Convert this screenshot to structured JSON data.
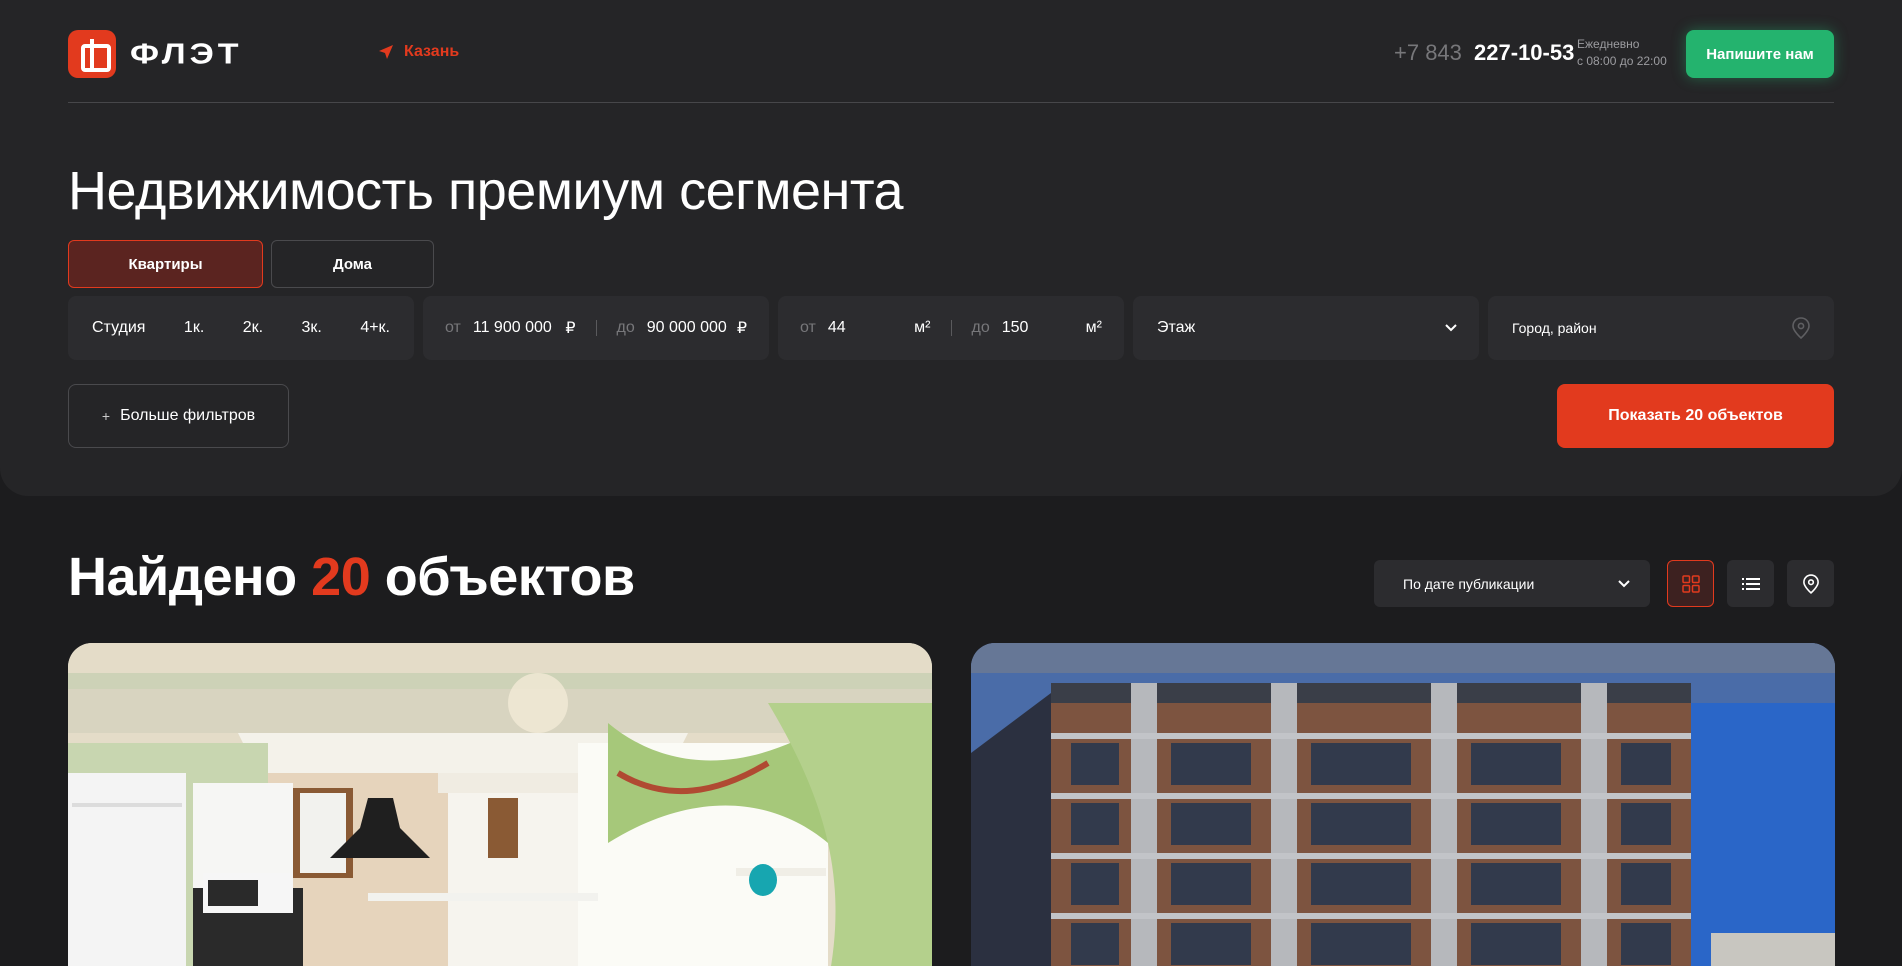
{
  "header": {
    "logo_text": "ФЛЭТ",
    "city": "Казань",
    "phone_prefix": "+7 843",
    "phone_number": "227-10-53",
    "hours_line1": "Ежедневно",
    "hours_line2": "с 08:00 до 22:00",
    "write_button": "Напишите нам"
  },
  "hero": {
    "title": "Недвижимость премиум сегмента",
    "segments": [
      "Квартиры",
      "Дома"
    ],
    "rooms": [
      "Студия",
      "1к.",
      "2к.",
      "3к.",
      "4+к."
    ],
    "price": {
      "from_label": "от",
      "from_value": "11 900 000",
      "to_label": "до",
      "to_value": "90 000 000",
      "currency": "₽"
    },
    "area": {
      "from_label": "от",
      "from_value": "44",
      "to_label": "до",
      "to_value": "150",
      "unit": "м²"
    },
    "floor_placeholder": "Этаж",
    "location_placeholder": "Город, район",
    "more_filters": "Больше фильтров",
    "show_button": "Показать 20 объектов"
  },
  "results": {
    "title_prefix": "Найдено",
    "count": "20",
    "title_suffix": "объектов",
    "sort_value": "По дате публикации"
  },
  "colors": {
    "accent": "#e23a1e",
    "green": "#24b36e",
    "background": "#1c1c1e",
    "panel": "#252527"
  }
}
